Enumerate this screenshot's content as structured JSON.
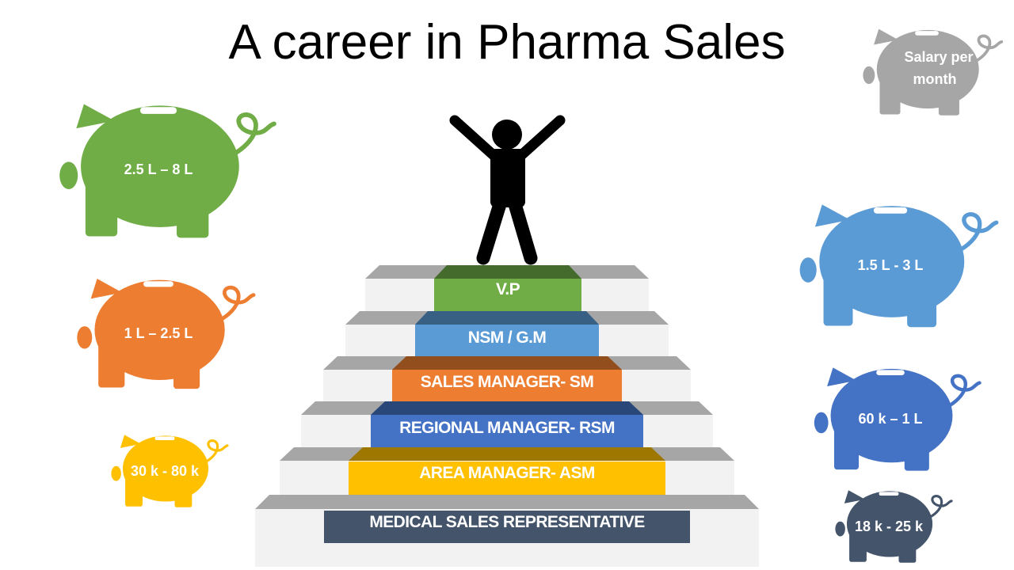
{
  "title": "A career in Pharma Sales",
  "legend": {
    "line1": "Salary per",
    "line2": "month",
    "color": "#A6A6A6"
  },
  "steps": [
    {
      "label": "MEDICAL SALES REPRESENTATIVE",
      "color": "#44546A"
    },
    {
      "label": "AREA MANAGER- ASM",
      "color": "#FFC000"
    },
    {
      "label": "REGIONAL MANAGER- RSM",
      "color": "#4472C4"
    },
    {
      "label": "SALES MANAGER- SM",
      "color": "#ED7D31"
    },
    {
      "label": "NSM / G.M",
      "color": "#5B9BD5"
    },
    {
      "label": "V.P",
      "color": "#70AD47"
    }
  ],
  "salaries": [
    {
      "label": "2.5 L – 8 L",
      "color": "#70AD47"
    },
    {
      "label": "1 L – 2.5 L",
      "color": "#ED7D31"
    },
    {
      "label": "30 k - 80 k",
      "color": "#FFC000"
    },
    {
      "label": "1.5 L - 3 L",
      "color": "#5B9BD5"
    },
    {
      "label": "60 k – 1 L",
      "color": "#4472C4"
    },
    {
      "label": "18 k - 25 k",
      "color": "#44546A"
    }
  ],
  "figure_icon": "person-arms-raised-icon",
  "piggy_icon": "piggy-bank-icon"
}
